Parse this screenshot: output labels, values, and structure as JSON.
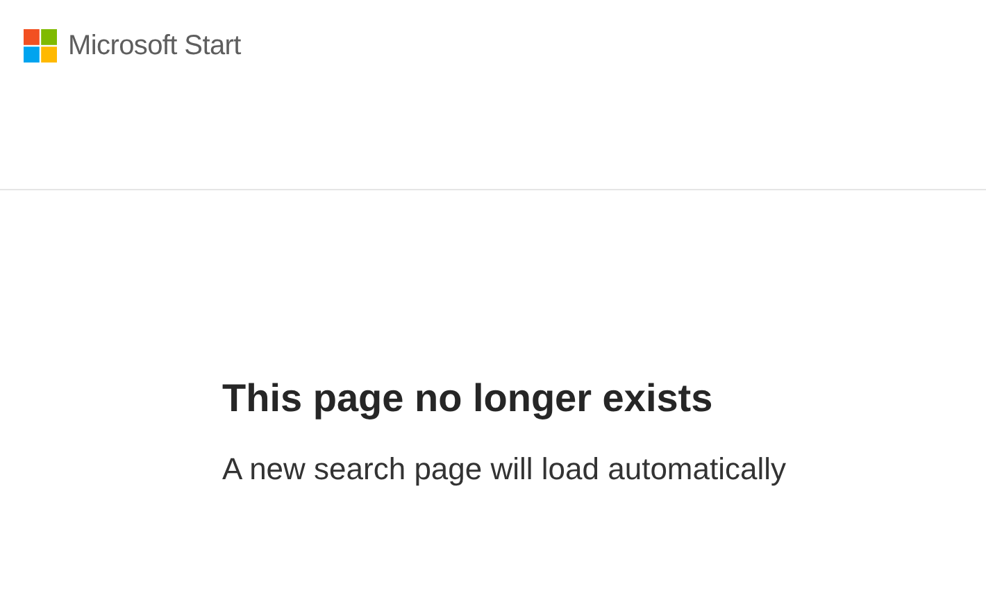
{
  "header": {
    "brand": "Microsoft Start"
  },
  "message": {
    "title": "This page no longer exists",
    "subtitle": "A new search page will load automatically"
  }
}
